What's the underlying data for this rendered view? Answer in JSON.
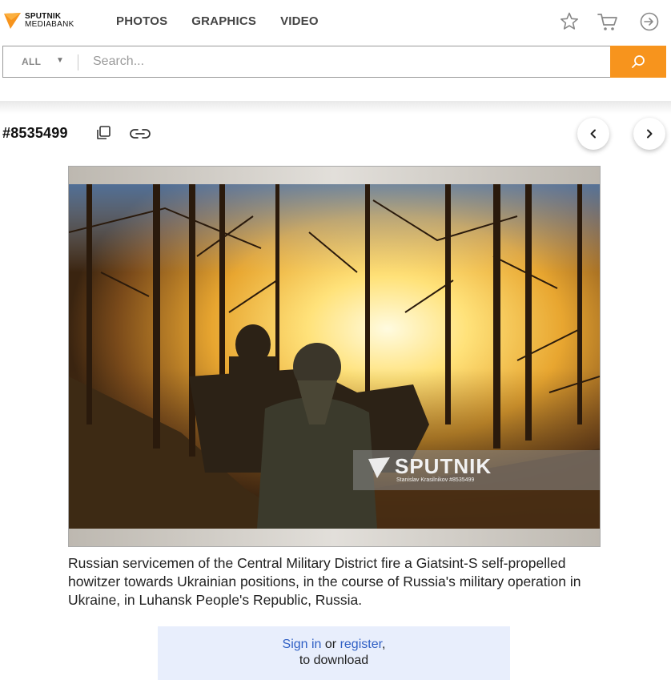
{
  "header": {
    "logo_line1": "SPUTNIK",
    "logo_line2": "MEDIABANK",
    "nav": [
      {
        "label": "PHOTOS"
      },
      {
        "label": "GRAPHICS"
      },
      {
        "label": "VIDEO"
      }
    ],
    "icons": [
      "star-icon",
      "cart-icon",
      "sign-in-icon"
    ]
  },
  "search": {
    "filter_label": "ALL",
    "filter_caret": "▼",
    "placeholder": "Search...",
    "value": ""
  },
  "media": {
    "id": "#8535499",
    "watermark_brand": "SPUTNIK",
    "watermark_credit": "Stanislav Krasilnikov #8535499",
    "caption": "Russian servicemen of the Central Military District fire a Giatsint-S self-propelled howitzer towards Ukrainian positions, in the course of Russia's military operation in Ukraine, in Luhansk People's Republic, Russia."
  },
  "download_prompt": {
    "signin_label": "Sign in",
    "or_text": " or ",
    "register_label": "register",
    "comma": ",",
    "line2": "to download"
  },
  "colors": {
    "accent": "#f7941d",
    "link": "#2f5fc4",
    "signin_bg": "#e8eefc"
  }
}
